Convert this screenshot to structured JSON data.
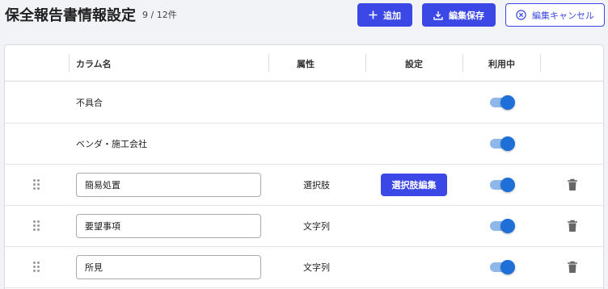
{
  "header": {
    "title": "保全報告書情報設定",
    "count": "9 / 12件",
    "add_label": "追加",
    "save_label": "編集保存",
    "cancel_label": "編集キャンセル"
  },
  "table": {
    "columns": {
      "name": "カラム名",
      "attribute": "属性",
      "setting": "設定",
      "in_use": "利用中"
    },
    "rows": [
      {
        "name": "不具合",
        "editable": false,
        "attribute": "",
        "setting": "",
        "in_use": true
      },
      {
        "name": "ベンダ・施工会社",
        "editable": false,
        "attribute": "",
        "setting": "",
        "in_use": true
      },
      {
        "name": "簡易処置",
        "editable": true,
        "attribute": "選択肢",
        "setting": "選択肢編集",
        "in_use": true
      },
      {
        "name": "要望事項",
        "editable": true,
        "attribute": "文字列",
        "setting": "",
        "in_use": true
      },
      {
        "name": "所見",
        "editable": true,
        "attribute": "文字列",
        "setting": "",
        "in_use": true
      }
    ]
  },
  "colors": {
    "primary": "#3c48e6",
    "toggle_thumb": "#1f6fd8",
    "toggle_track": "#8fb8ea",
    "background": "#f2f3f7"
  },
  "icons": {
    "add": "plus-icon",
    "save": "download-icon",
    "cancel": "close-circle-icon",
    "drag": "drag-handle-icon",
    "delete": "trash-icon"
  }
}
